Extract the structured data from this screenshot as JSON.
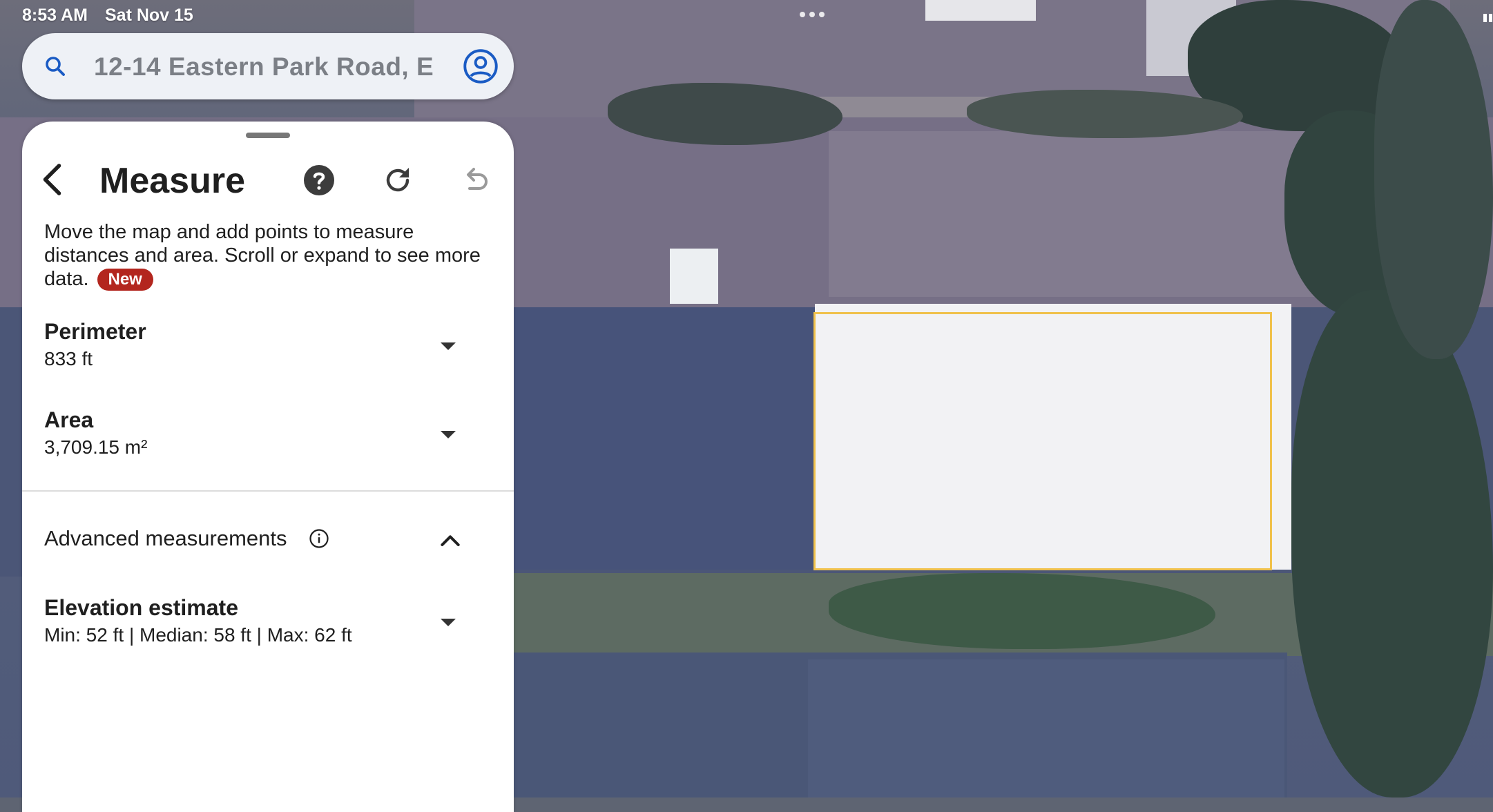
{
  "status_bar": {
    "time": "8:53 AM",
    "date": "Sat Nov 15"
  },
  "search": {
    "value": "12-14 Eastern Park Road, E",
    "icons": {
      "search": "search-icon",
      "account": "account-circle-icon"
    }
  },
  "measure_panel": {
    "title": "Measure",
    "description": "Move the map and add points to measure distances and area. Scroll or expand to see more data.",
    "new_badge": "New",
    "toolbar_icons": [
      "back-icon",
      "help-icon",
      "refresh-icon",
      "undo-icon"
    ],
    "perimeter": {
      "label": "Perimeter",
      "value": "833 ft"
    },
    "area": {
      "label": "Area",
      "value": "3,709.15 m²"
    },
    "advanced": {
      "label": "Advanced measurements",
      "icons": [
        "info-icon",
        "chevron-up-icon"
      ]
    },
    "elevation": {
      "label": "Elevation estimate",
      "value": "Min: 52 ft | Median: 58 ft | Max: 62 ft"
    }
  },
  "colors": {
    "measure_outline": "#f0c14b",
    "accent_blue": "#1a5bc4",
    "badge_red": "#b3261e"
  }
}
